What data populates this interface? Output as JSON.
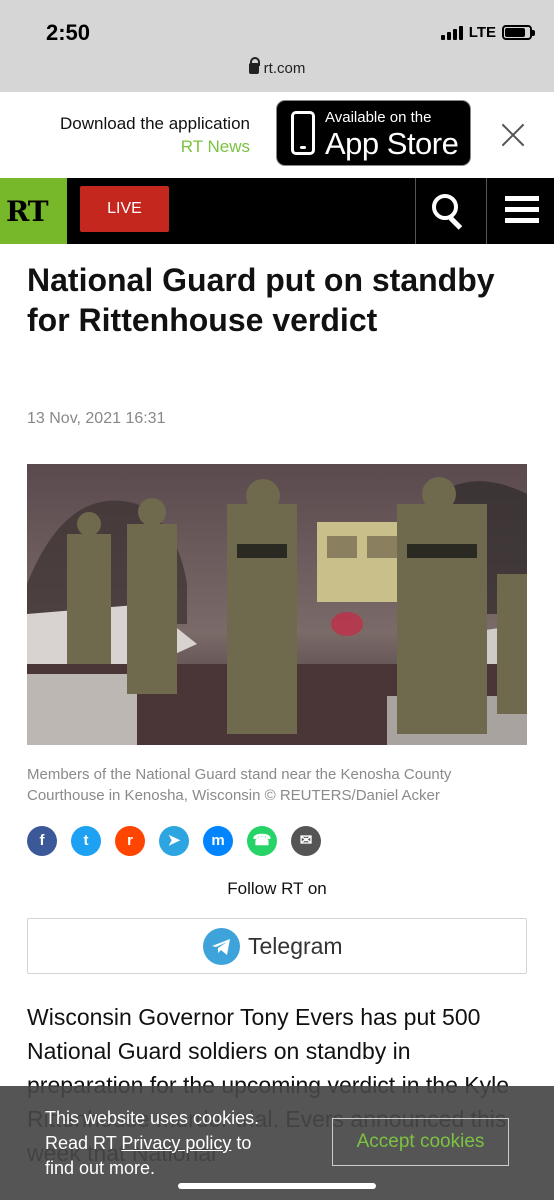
{
  "status_bar": {
    "time": "2:50",
    "network": "LTE"
  },
  "browser": {
    "url": "rt.com"
  },
  "app_banner": {
    "line1": "Download the application",
    "line2": "RT News",
    "appstore_top": "Available on the",
    "appstore_main": "App Store"
  },
  "header": {
    "logo": "RT",
    "live_label": "LIVE"
  },
  "article": {
    "headline": "National Guard put on standby for Rittenhouse verdict",
    "date": "13 Nov, 2021 16:31",
    "caption": "Members of the National Guard stand near the Kenosha County Courthouse in Kenosha, Wisconsin ©  REUTERS/Daniel Acker",
    "body": "Wisconsin Governor Tony Evers has put 500 National Guard soldiers on standby in preparation for the upcoming verdict in the Kyle Rittenhouse murder trial. Evers announced this week that National"
  },
  "share": {
    "icons": [
      "facebook-icon",
      "twitter-icon",
      "reddit-icon",
      "telegram-icon",
      "messenger-icon",
      "whatsapp-icon",
      "email-icon"
    ],
    "colors": [
      "#3b5998",
      "#1da1f2",
      "#ff4500",
      "#2ca5e0",
      "#0084ff",
      "#25d366",
      "#555555"
    ]
  },
  "follow": {
    "label": "Follow RT on",
    "telegram_label": "Telegram"
  },
  "cookie": {
    "line1": "This website uses cookies.",
    "read": "Read RT ",
    "link": "Privacy policy",
    "to": " to",
    "line3": "find out more.",
    "accept": "Accept cookies"
  },
  "colors": {
    "rt_green": "#77b82a",
    "live_red": "#c4271d",
    "accent_green": "#7cc242"
  }
}
